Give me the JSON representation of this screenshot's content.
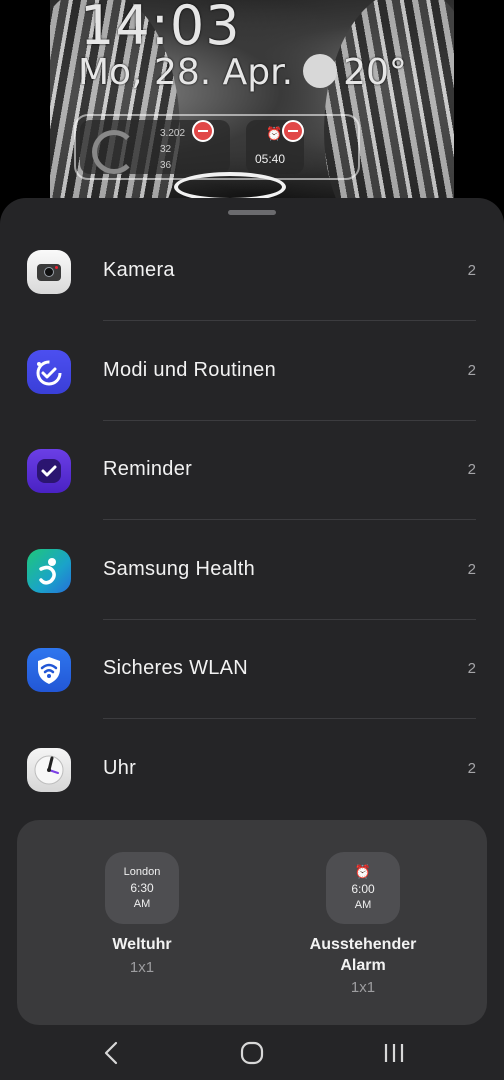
{
  "lockscreen": {
    "time": "14:03",
    "date": "Mo, 28. Apr.",
    "temperature": "20°",
    "stats": [
      "3.202",
      "32",
      "36"
    ],
    "alarm_time": "05:40"
  },
  "apps": [
    {
      "name": "Kamera",
      "count": "2",
      "icon": "camera-icon"
    },
    {
      "name": "Modi und Routinen",
      "count": "2",
      "icon": "modes-routines-icon"
    },
    {
      "name": "Reminder",
      "count": "2",
      "icon": "reminder-icon"
    },
    {
      "name": "Samsung Health",
      "count": "2",
      "icon": "samsung-health-icon"
    },
    {
      "name": "Sicheres WLAN",
      "count": "2",
      "icon": "secure-wifi-icon"
    },
    {
      "name": "Uhr",
      "count": "2",
      "icon": "clock-icon"
    }
  ],
  "widgets": {
    "world_clock": {
      "city": "London",
      "time": "6:30",
      "ampm": "AM",
      "name": "Weltuhr",
      "size": "1x1"
    },
    "alarm": {
      "time": "6:00",
      "ampm": "AM",
      "name_line1": "Ausstehender",
      "name_line2": "Alarm",
      "size": "1x1"
    }
  },
  "navigation": {
    "back": "back-icon",
    "home": "home-icon",
    "recents": "recents-icon"
  },
  "colors": {
    "sheet": "#252527",
    "panel": "#3a3a3c",
    "accent_blue": "#2f76ee",
    "accent_purple": "#6b3fe6"
  }
}
